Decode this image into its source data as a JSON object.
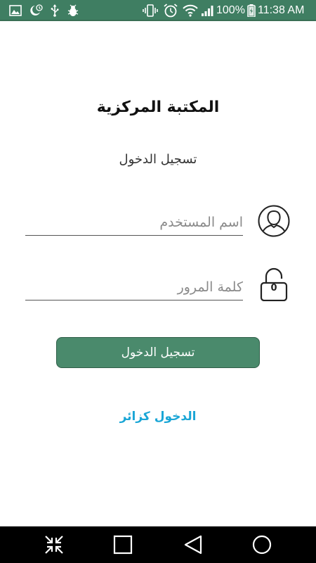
{
  "status_bar": {
    "battery_percent": "100%",
    "time": "11:38 AM",
    "left_icons": [
      "image-icon",
      "moon-icon",
      "usb-icon",
      "bug-icon"
    ],
    "right_icons": [
      "vibrate-icon",
      "alarm-icon",
      "wifi-icon",
      "signal-icon",
      "battery-icon"
    ],
    "background_color": "#3f7e62"
  },
  "app": {
    "title": "المكتبة المركزية",
    "section_title": "تسجيل الدخول"
  },
  "form": {
    "username": {
      "value": "",
      "placeholder": "اسم المستخدم",
      "icon": "user-icon"
    },
    "password": {
      "value": "",
      "placeholder": "كلمة المرور",
      "icon": "lock-icon",
      "lock_digit": "0"
    },
    "login_button_label": "تسجيل الدخول",
    "login_button_color": "#4a8a6c",
    "guest_link_label": "الدخول كزائر",
    "guest_link_color": "#1aa6d6"
  },
  "nav_bar": {
    "buttons": [
      "collapse-icon",
      "recents-icon",
      "back-icon",
      "home-icon"
    ]
  }
}
